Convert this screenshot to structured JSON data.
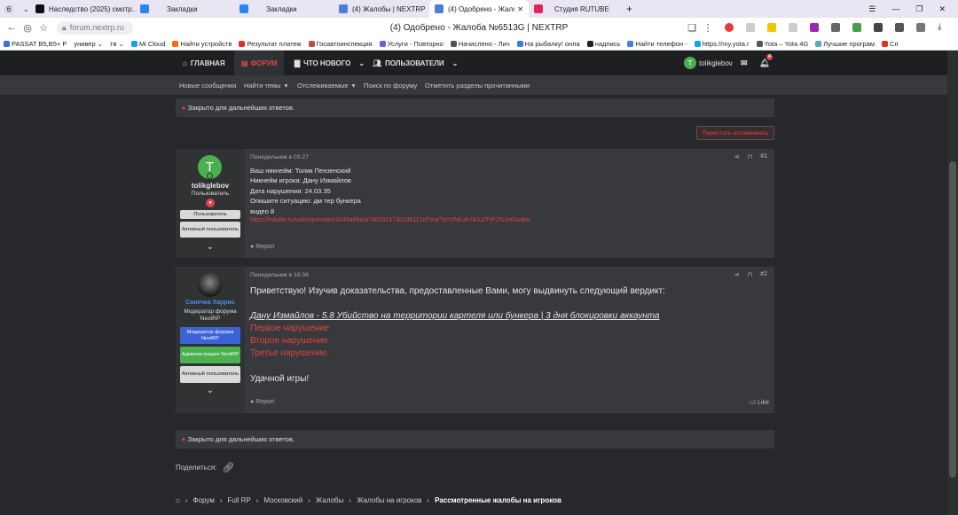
{
  "browser": {
    "tabs": [
      {
        "label": "",
        "icon": "browser-menu-icon"
      },
      {
        "label": "Наследство (2025) смотр...",
        "icon": "kinopoisk-icon",
        "color": "#111"
      },
      {
        "label": "Закладки",
        "icon": "vk-icon",
        "color": "#2787f5"
      },
      {
        "label": "Закладки",
        "icon": "vk-icon",
        "color": "#2787f5"
      },
      {
        "label": "(4) Жалобы | NEXTRP",
        "icon": "nextrp-icon",
        "color": "#4a7fd6"
      },
      {
        "label": "(4) Одобрено - Жалоба",
        "icon": "nextrp-icon",
        "color": "#4a7fd6"
      },
      {
        "label": "Студия RUTUBE",
        "icon": "rutube-icon",
        "color": "#e0245e"
      }
    ],
    "tab_count": "6",
    "url": "forum.nextrp.ru",
    "page_title": "(4) Одобрено - Жалоба №6513G | NEXTRP",
    "bookmarks": [
      {
        "label": "PASSAT B5,B5+ P",
        "color": "#3b6fd6"
      },
      {
        "label": "универ ⌄",
        "color": "#888"
      },
      {
        "label": "тв ⌄",
        "color": "#888"
      },
      {
        "label": "Mi Cloud",
        "color": "#1aa0e6"
      },
      {
        "label": "Найти устройств",
        "color": "#ff6a00"
      },
      {
        "label": "Результат платеж",
        "color": "#d32"
      },
      {
        "label": "Госавтоинспекция",
        "color": "#a55"
      },
      {
        "label": "Услуги - Повторно",
        "color": "#7a5ad6"
      },
      {
        "label": "Начислено - Лич",
        "color": "#555"
      },
      {
        "label": "На рыбалку! онла",
        "color": "#3a7bd5"
      },
      {
        "label": "надпись",
        "color": "#222"
      },
      {
        "label": "Найти телефон -",
        "color": "#4a7fd6"
      },
      {
        "label": "https://my.yota.r",
        "color": "#1aa0e6"
      },
      {
        "label": "Yota – Yota 4G",
        "color": "#555"
      },
      {
        "label": "Лучшие програм",
        "color": "#5ab"
      },
      {
        "label": "Сп",
        "color": "#d32"
      }
    ]
  },
  "site": {
    "nav": {
      "home": "ГЛАВНАЯ",
      "forum": "ФОРУМ",
      "whatsnew": "ЧТО НОВОГО",
      "users": "ПОЛЬЗОВАТЕЛИ",
      "username": "tolikglebov",
      "avatar_letter": "T",
      "alerts": "4"
    },
    "subnav": [
      "Новые сообщения",
      "Найти темы",
      "Отслеживаемые",
      "Поиск по форуму",
      "Отметить разделы прочитанными"
    ],
    "closed_notice": "Закрыто для дальнейших ответов.",
    "unwatch": "Перестать отслеживать",
    "share": "Поделиться:",
    "breadcrumbs": [
      "Форум",
      "Full RP",
      "Московский",
      "Жалобы",
      "Жалобы на игроков",
      "Рассмотренные жалобы на игроков"
    ]
  },
  "posts": [
    {
      "username": "tolikglebov",
      "avatar_letter": "T",
      "user_title": "Пользователь",
      "badges": [
        "Пользователь",
        "Активный пользователь"
      ],
      "time": "Понедельник в 03:27",
      "number": "#1",
      "lines": [
        "Ваш никнейм: Толик Пензенский",
        "Никнейм игрока: Дану Измайлов",
        "Дата нарушения: 24.03.35",
        "Опишите ситуацию: дм тер бункера",
        "видео 8"
      ],
      "link": "https://rutube.ru/video/private/c3246a6fa0a780391573c10b112cf7ea/?p=VNKzk78JuZPjFZNJnGuobw",
      "report": "Report"
    },
    {
      "username": "Санечка Харрис",
      "user_title": "Модератор форума NextRP",
      "badges": [
        "Модератор форума NextRP",
        "Администрация NextRP",
        "Активный пользователь"
      ],
      "time": "Понедельник в 16:36",
      "number": "#2",
      "greeting": "Приветствую! Изучив доказательства, предоставленные Вами, могу выдвинуть следующий вердикт:",
      "verdict": "Дану Измайлов - 5.8 Убийство на территории картеля или бункера | 3 дня блокировки аккаунта",
      "violations": [
        "Первое нарушение",
        "Второе нарушение",
        "Третье нарушение."
      ],
      "closing": "Удачной игры!",
      "report": "Report",
      "like": "Like"
    }
  ],
  "colors": {
    "accent": "#e04444",
    "moderator_name": "#4a90e2",
    "moderator_badge": "#3c63d6",
    "admin_badge": "#4caf50",
    "online": "#4caf50"
  }
}
